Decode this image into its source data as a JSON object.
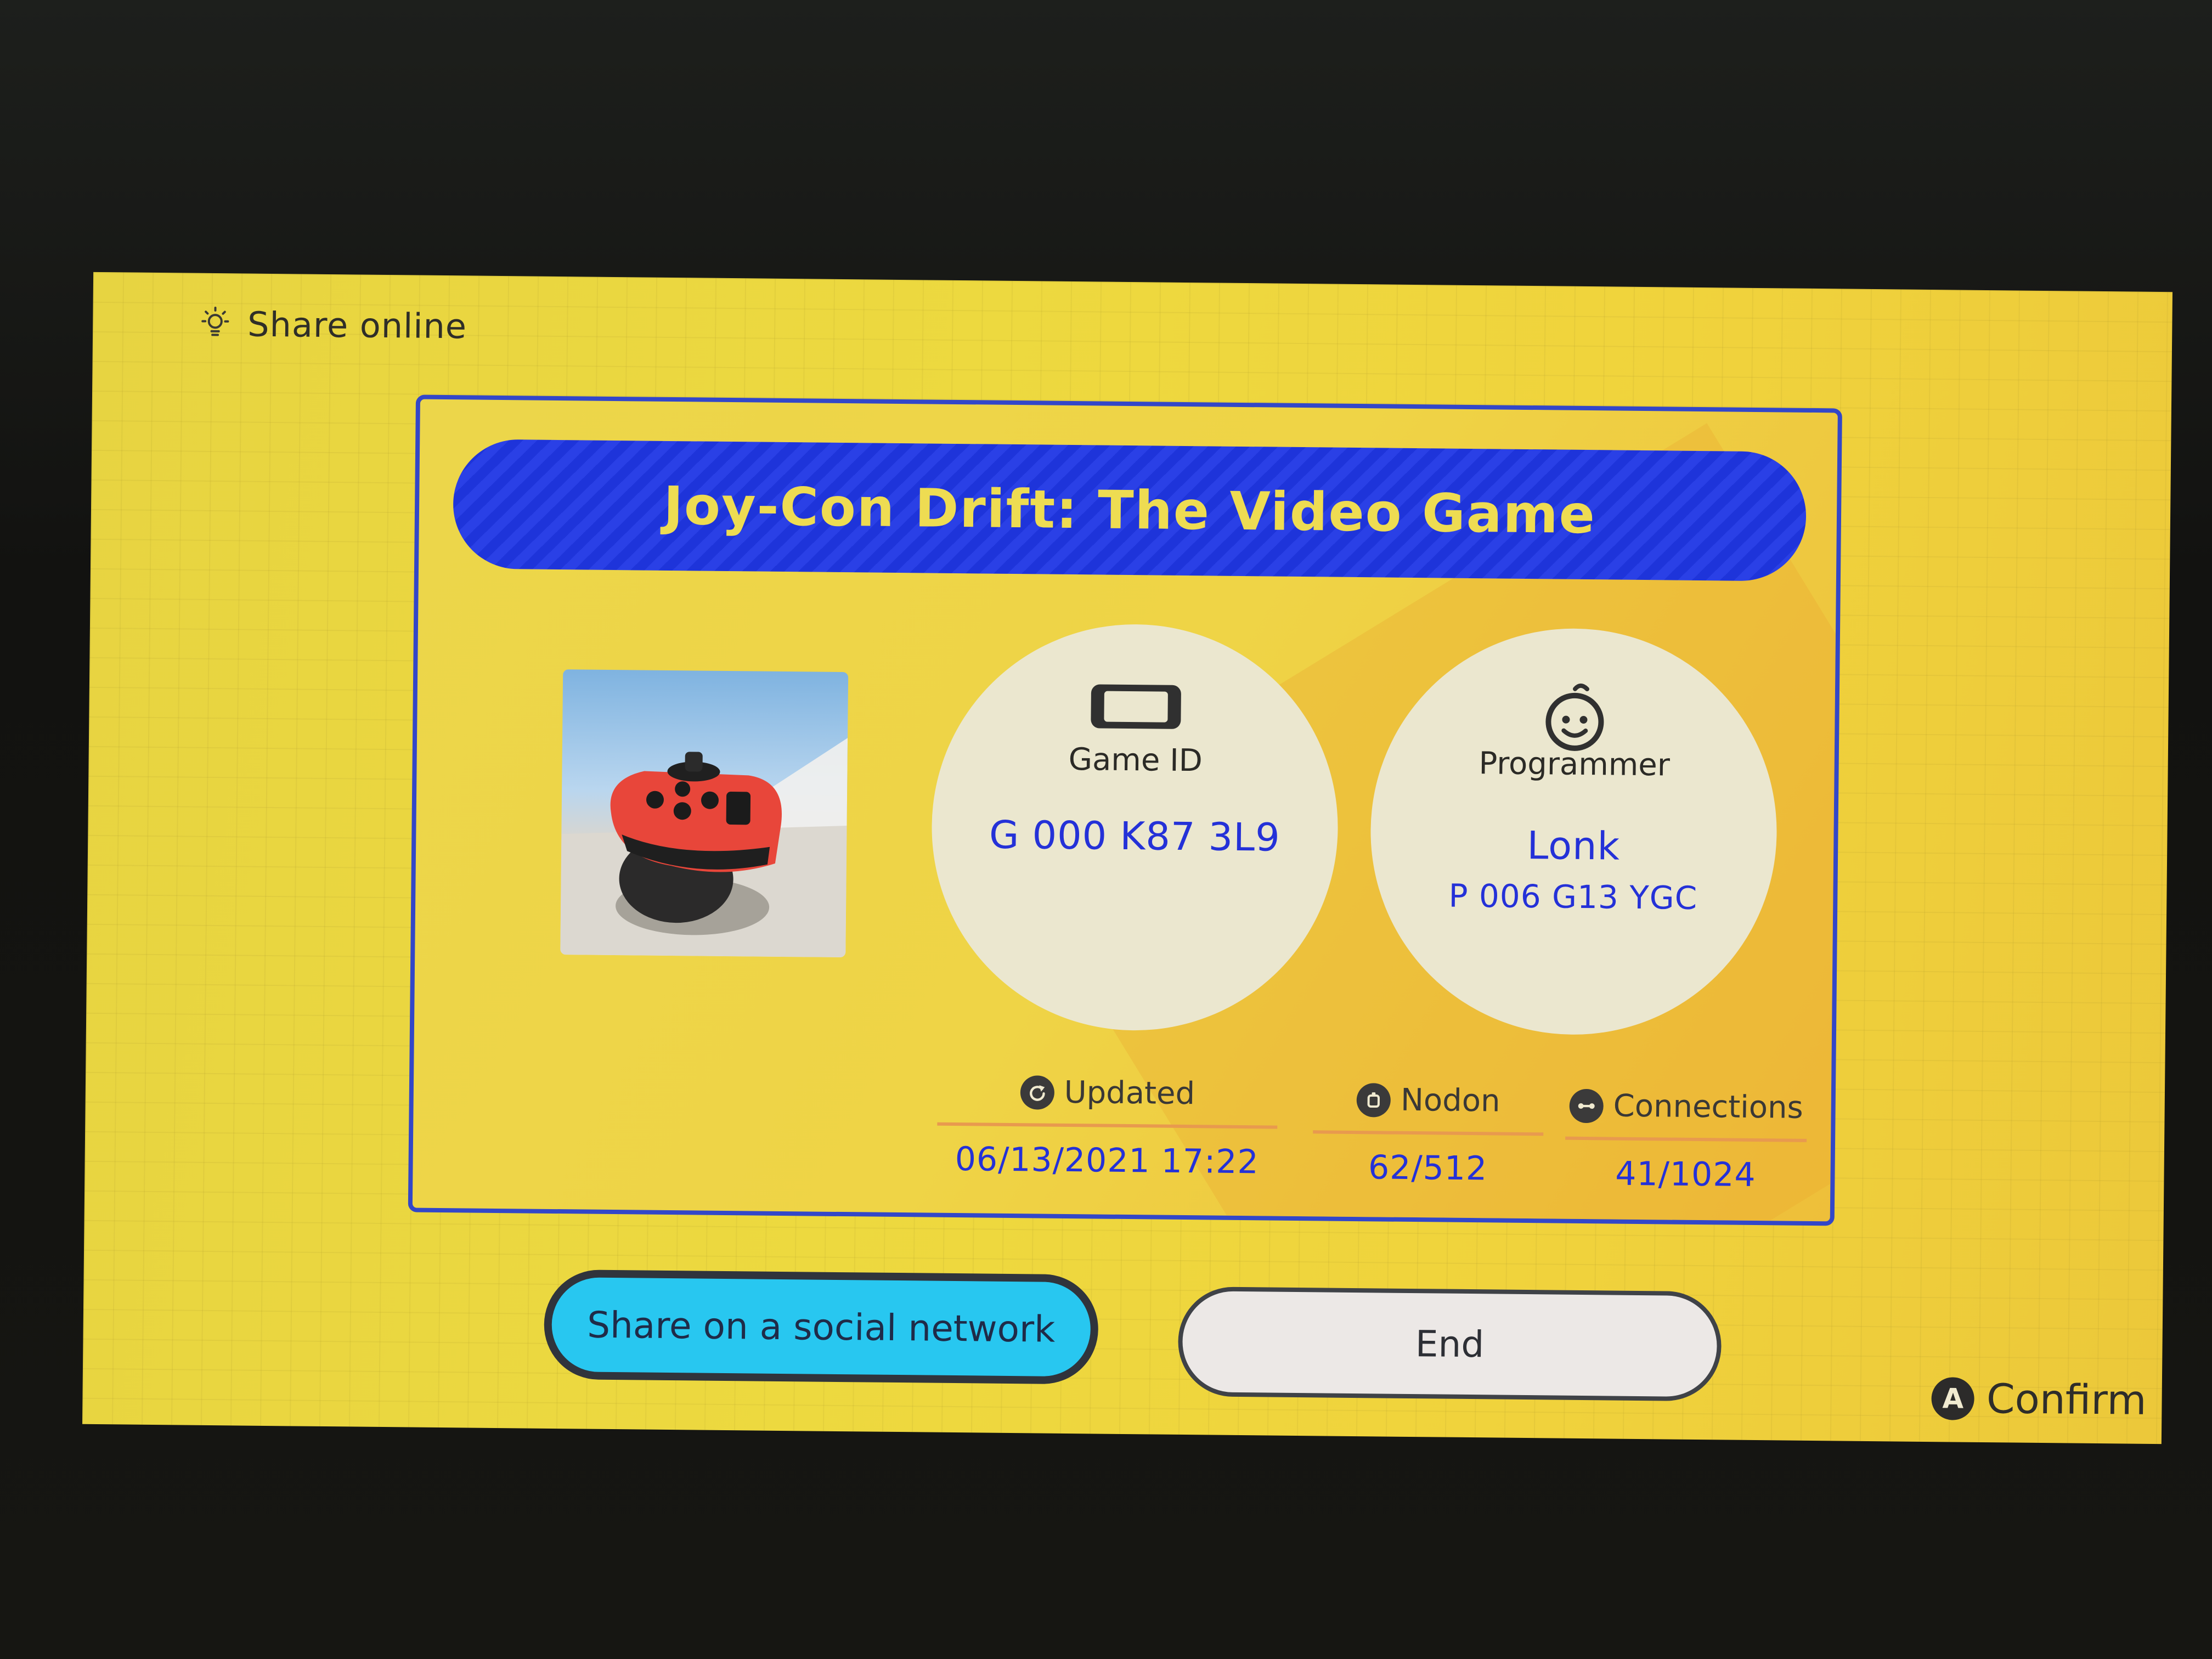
{
  "header": {
    "title": "Share online",
    "icon": "lightbulb-icon"
  },
  "game": {
    "title": "Joy-Con Drift: The Video Game",
    "thumbnail_icon": "joy-con-thumbnail"
  },
  "game_id": {
    "label": "Game ID",
    "value": "G 000 K87 3L9",
    "icon": "console-icon"
  },
  "programmer": {
    "label": "Programmer",
    "name": "Lonk",
    "id": "P 006 G13 YGC",
    "icon": "smiley-icon"
  },
  "stats": {
    "updated": {
      "label": "Updated",
      "value": "06/13/2021 17:22",
      "icon": "refresh-icon"
    },
    "nodon": {
      "label": "Nodon",
      "value": "62/512",
      "icon": "nodon-icon"
    },
    "connections": {
      "label": "Connections",
      "value": "41/1024",
      "icon": "link-icon"
    }
  },
  "buttons": {
    "share": "Share on a social network",
    "end": "End"
  },
  "hint": {
    "button": "A",
    "label": "Confirm"
  },
  "colors": {
    "background": "#edd93f",
    "banner": "#1e34da",
    "accent_text": "#2431d8",
    "share_button": "#28c7f0"
  }
}
